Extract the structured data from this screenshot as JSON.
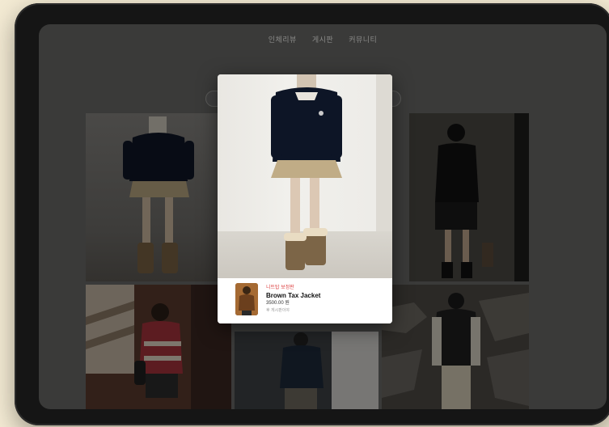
{
  "nav": {
    "items": [
      "인체리뷰",
      "게시판",
      "커뮤니티"
    ]
  },
  "modal": {
    "product": {
      "category": "니트탑 보정판",
      "name": "Brown Tax Jacket",
      "price": "3500.00 원",
      "meta": "후 게시판이야"
    }
  },
  "colors": {
    "background": "#f3ead3",
    "device": "#151515",
    "screen": "#3a3a39",
    "accent": "#dd4444"
  }
}
